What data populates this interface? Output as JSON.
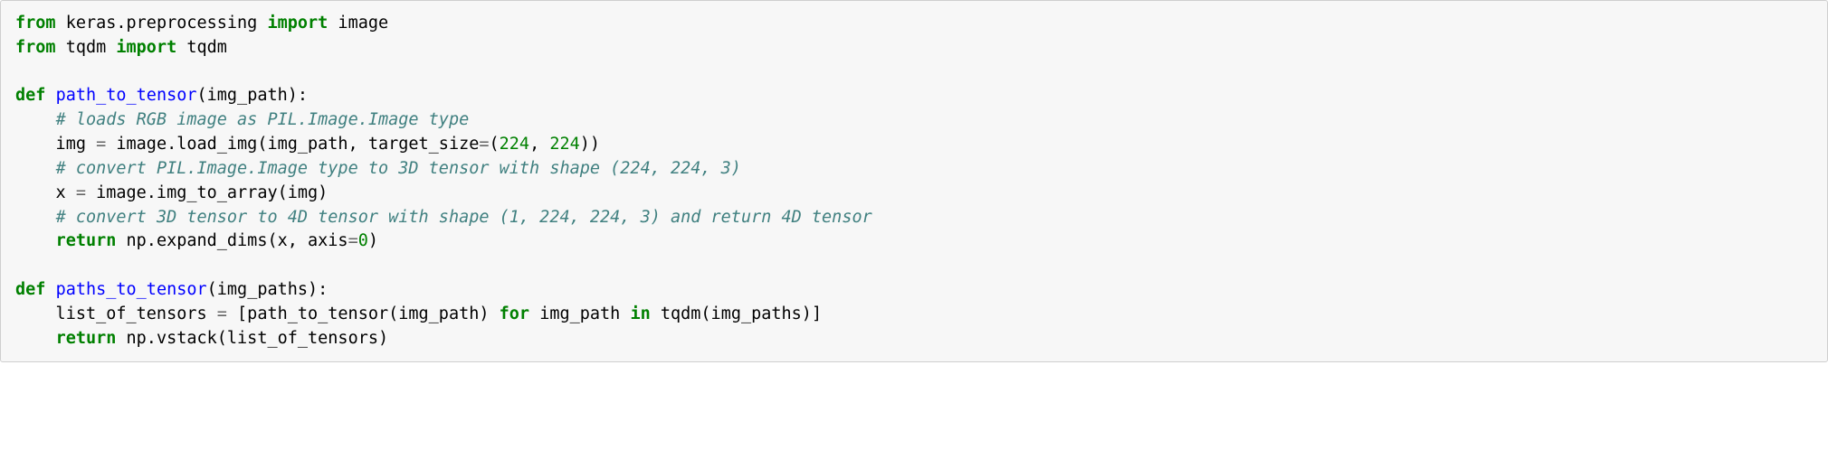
{
  "code": {
    "lines": [
      {
        "tokens": [
          [
            "kw",
            "from"
          ],
          [
            "",
            ""
          ],
          [
            "",
            " keras.preprocessing "
          ],
          [
            "kw",
            "import"
          ],
          [
            "",
            " image"
          ]
        ]
      },
      {
        "tokens": [
          [
            "kw",
            "from"
          ],
          [
            "",
            " tqdm "
          ],
          [
            "kw",
            "import"
          ],
          [
            "",
            " tqdm"
          ]
        ]
      },
      {
        "tokens": [
          [
            "",
            ""
          ]
        ]
      },
      {
        "tokens": [
          [
            "kw",
            "def"
          ],
          [
            "",
            " "
          ],
          [
            "fn",
            "path_to_tensor"
          ],
          [
            "",
            "(img_path):"
          ]
        ]
      },
      {
        "tokens": [
          [
            "",
            "    "
          ],
          [
            "c1",
            "# loads RGB image as PIL.Image.Image type"
          ]
        ]
      },
      {
        "tokens": [
          [
            "",
            "    img "
          ],
          [
            "op",
            "="
          ],
          [
            "",
            " image.load_img(img_path, target_size"
          ],
          [
            "op",
            "="
          ],
          [
            "",
            "("
          ],
          [
            "num",
            "224"
          ],
          [
            "",
            ", "
          ],
          [
            "num",
            "224"
          ],
          [
            "",
            "))"
          ]
        ]
      },
      {
        "tokens": [
          [
            "",
            "    "
          ],
          [
            "c1",
            "# convert PIL.Image.Image type to 3D tensor with shape (224, 224, 3)"
          ]
        ]
      },
      {
        "tokens": [
          [
            "",
            "    x "
          ],
          [
            "op",
            "="
          ],
          [
            "",
            " image.img_to_array(img)"
          ]
        ]
      },
      {
        "tokens": [
          [
            "",
            "    "
          ],
          [
            "c1",
            "# convert 3D tensor to 4D tensor with shape (1, 224, 224, 3) and return 4D tensor"
          ]
        ]
      },
      {
        "tokens": [
          [
            "",
            "    "
          ],
          [
            "kw",
            "return"
          ],
          [
            "",
            " np.expand_dims(x, axis"
          ],
          [
            "op",
            "="
          ],
          [
            "num",
            "0"
          ],
          [
            "",
            ")"
          ]
        ]
      },
      {
        "tokens": [
          [
            "",
            ""
          ]
        ]
      },
      {
        "tokens": [
          [
            "kw",
            "def"
          ],
          [
            "",
            " "
          ],
          [
            "fn",
            "paths_to_tensor"
          ],
          [
            "",
            "(img_paths):"
          ]
        ]
      },
      {
        "tokens": [
          [
            "",
            "    list_of_tensors "
          ],
          [
            "op",
            "="
          ],
          [
            "",
            " [path_to_tensor(img_path) "
          ],
          [
            "kw",
            "for"
          ],
          [
            "",
            " img_path "
          ],
          [
            "kw",
            "in"
          ],
          [
            "",
            " tqdm(img_paths)]"
          ]
        ]
      },
      {
        "tokens": [
          [
            "",
            "    "
          ],
          [
            "kw",
            "return"
          ],
          [
            "",
            " np.vstack(list_of_tensors)"
          ]
        ]
      }
    ]
  }
}
